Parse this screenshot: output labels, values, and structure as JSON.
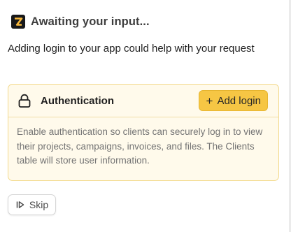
{
  "header": {
    "title": "Awaiting your input...",
    "logo_icon": "zapier-z-logo-icon"
  },
  "intro_text": "Adding login to your app could help with your request",
  "card": {
    "icon": "lock-icon",
    "title": "Authentication",
    "add_button_icon": "plus-icon",
    "add_button_label": "Add login",
    "description": "Enable authentication so clients can securely log in to view their projects, campaigns, invoices, and files. The Clients table will store user information."
  },
  "skip": {
    "icon": "skip-forward-icon",
    "label": "Skip"
  },
  "colors": {
    "card_background": "#fffaeb",
    "card_border": "#f3d98b",
    "accent_button": "#f6c644",
    "logo_background": "#17181a",
    "logo_accent": "#f6b73c"
  }
}
